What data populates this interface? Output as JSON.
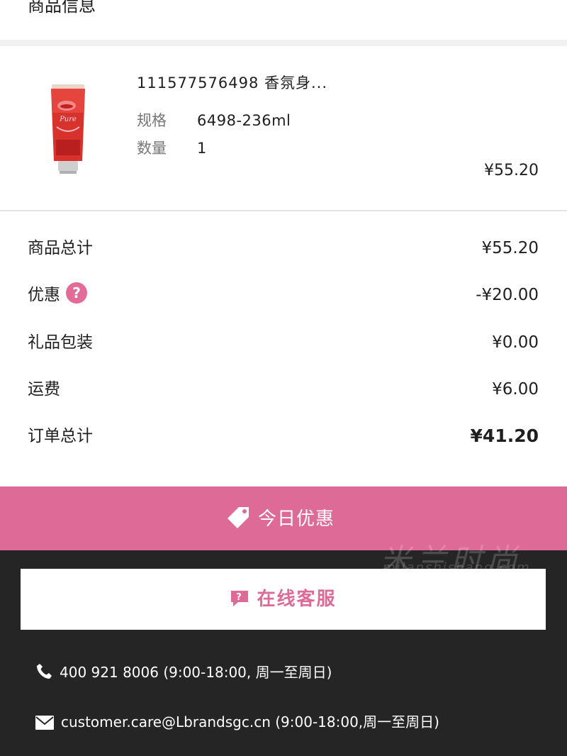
{
  "header": {
    "title": "商品信息"
  },
  "product": {
    "name": "111577576498 香氛身...",
    "spec_label": "规格",
    "spec_value": "6498-236ml",
    "qty_label": "数量",
    "qty_value": "1",
    "price": "¥55.20",
    "thumb_icon": "lotion-tube-image"
  },
  "summary": {
    "rows": [
      {
        "label": "商品总计",
        "amount": "¥55.20"
      },
      {
        "label": "优惠",
        "amount": "-¥20.00",
        "help": "?"
      },
      {
        "label": "礼品包装",
        "amount": "¥0.00"
      },
      {
        "label": "运费",
        "amount": "¥6.00"
      },
      {
        "label": "订单总计",
        "amount": "¥41.20"
      }
    ]
  },
  "promo": {
    "label": "今日优惠",
    "icon": "tag-icon",
    "color": "#dd6a97"
  },
  "footer": {
    "service_label": "在线客服",
    "service_icon": "chat-question-icon",
    "phone": "400 921 8006 (9:00-18:00, 周一至周日)",
    "email": "customer.care@Lbrandsgc.cn  (9:00-18:00,周一至周日)",
    "watermark_main": "米兰时尚",
    "watermark_sub": "milanshishang.com",
    "background": "#262525"
  }
}
